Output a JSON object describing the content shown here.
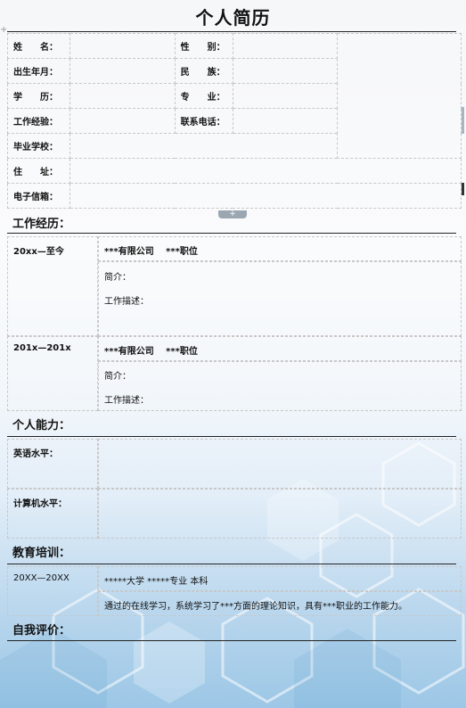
{
  "title": "个人简历",
  "basic_info": {
    "name_label": "姓　　名：",
    "gender_label": "性　　别：",
    "birth_label": "出生年月：",
    "ethnicity_label": "民　　族：",
    "education_label": "学　　历：",
    "major_label": "专　　业：",
    "experience_label": "工作经验：",
    "phone_label": "联系电话：",
    "school_label": "毕业学校：",
    "address_label": "住　　址：",
    "email_label": "电子信箱："
  },
  "work": {
    "heading": "工作经历：",
    "entries": [
      {
        "period": "20xx—至今",
        "company": "***有限公司　 ***职位",
        "intro": "简介：",
        "desc": "工作描述："
      },
      {
        "period": "201x—201x",
        "company": "***有限公司　 ***职位",
        "intro": "简介：",
        "desc": "工作描述："
      }
    ]
  },
  "ability": {
    "heading": "个人能力：",
    "english_label": "英语水平：",
    "computer_label": "计算机水平："
  },
  "education": {
    "heading": "教育培训：",
    "period": "20XX—20XX",
    "school_line": "*****大学 *****专业 本科",
    "detail": "通过的在线学习，系统学习了***方面的理论知识，具有***职业的工作能力。"
  },
  "self_eval": {
    "heading": "自我评价："
  },
  "ui": {
    "expand_glyph": "+",
    "corner_glyph": "+"
  },
  "colors": {
    "accent": "#9cc7e6",
    "border": "#c8c8c8"
  }
}
